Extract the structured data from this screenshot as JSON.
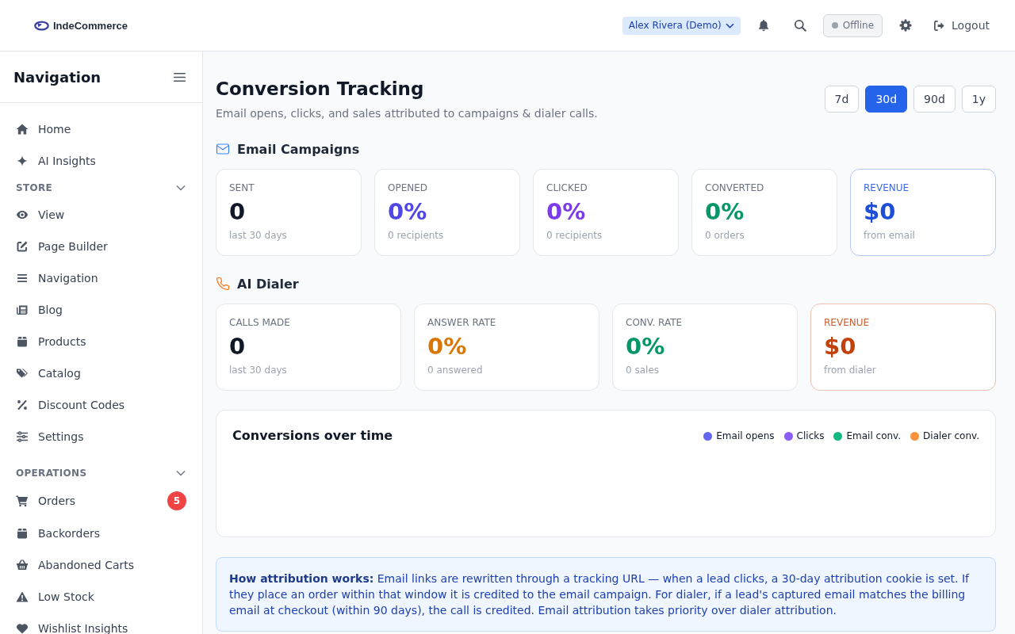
{
  "header": {
    "brand": "IndeCommerce",
    "user_menu": "Alex Rivera (Demo)",
    "status": {
      "label": "Offline",
      "online": false
    },
    "logout": "Logout"
  },
  "sidebar": {
    "title": "Navigation",
    "items": [
      {
        "label": "Home",
        "selected": false
      },
      {
        "label": "AI Insights",
        "selected": false
      }
    ],
    "sections": [
      {
        "title": "STORE",
        "expanded": true,
        "items": [
          {
            "label": "View",
            "selected": false
          },
          {
            "label": "Page Builder",
            "selected": false
          },
          {
            "label": "Navigation",
            "selected": false
          },
          {
            "label": "Blog",
            "selected": false
          },
          {
            "label": "Products",
            "selected": false
          },
          {
            "label": "Catalog",
            "selected": false
          },
          {
            "label": "Discount Codes",
            "selected": false
          },
          {
            "label": "Settings",
            "selected": false
          }
        ]
      },
      {
        "title": "OPERATIONS",
        "expanded": true,
        "items": [
          {
            "label": "Orders",
            "selected": false,
            "badge": "5"
          },
          {
            "label": "Backorders",
            "selected": false
          },
          {
            "label": "Abandoned Carts",
            "selected": false
          },
          {
            "label": "Low Stock",
            "selected": false
          },
          {
            "label": "Wishlist Insights",
            "selected": false
          }
        ]
      }
    ]
  },
  "page": {
    "title": "Conversion Tracking",
    "subtitle": "Email opens, clicks, and sales attributed to campaigns & dialer calls.",
    "ranges": [
      {
        "label": "7d",
        "selected": false
      },
      {
        "label": "30d",
        "selected": true
      },
      {
        "label": "90d",
        "selected": false
      },
      {
        "label": "1y",
        "selected": false
      }
    ]
  },
  "email_campaigns": {
    "title": "Email Campaigns",
    "cards": [
      {
        "kind": "plain",
        "label": "SENT",
        "value": "0",
        "note": "last 30 days",
        "color": "#111827"
      },
      {
        "kind": "plain",
        "label": "OPENED",
        "value": "0%",
        "note": "0 recipients",
        "color": "#4f46e5"
      },
      {
        "kind": "plain",
        "label": "CLICKED",
        "value": "0%",
        "note": "0 recipients",
        "color": "#7c3aed"
      },
      {
        "kind": "plain",
        "label": "CONVERTED",
        "value": "0%",
        "note": "0 orders",
        "color": "#059669"
      },
      {
        "kind": "accent",
        "label": "REVENUE",
        "value": "$0",
        "note": "from email",
        "color": "#1d4ed8"
      }
    ]
  },
  "ai_dialer": {
    "title": "AI Dialer",
    "cards": [
      {
        "kind": "plain",
        "label": "CALLS MADE",
        "value": "0",
        "note": "last 30 days",
        "color": "#111827"
      },
      {
        "kind": "plain",
        "label": "ANSWER RATE",
        "value": "0%",
        "note": "0 answered",
        "color": "#d97706"
      },
      {
        "kind": "plain",
        "label": "CONV. RATE",
        "value": "0%",
        "note": "0 sales",
        "color": "#059669"
      },
      {
        "kind": "accent",
        "label": "REVENUE",
        "value": "$0",
        "note": "from dialer",
        "color": "#c2410c"
      }
    ]
  },
  "chart": {
    "title": "Conversions over time",
    "legend": [
      {
        "label": "Email opens",
        "color": "#6366f1"
      },
      {
        "label": "Clicks",
        "color": "#8b5cf6"
      },
      {
        "label": "Email conv.",
        "color": "#10b981"
      },
      {
        "label": "Dialer conv.",
        "color": "#fb923c"
      }
    ]
  },
  "attribution_note": "**How attribution works:** Email links are rewritten through a tracking URL — when a lead clicks, a 30-day attribution cookie is set. If they place an order within that window it is credited to the email campaign. For dialer, if a lead's captured email matches the billing email at checkout (within 90 days), the call is credited. Email attribution takes priority over dialer attribution."
}
